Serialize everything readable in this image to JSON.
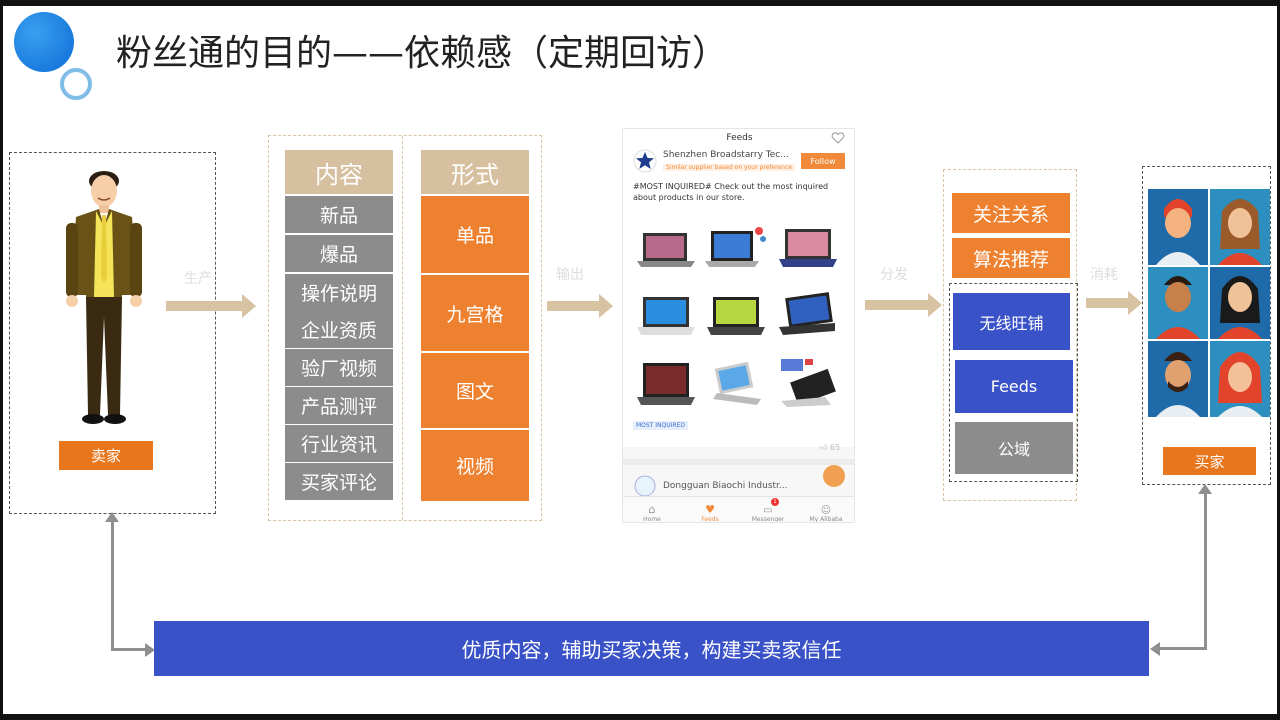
{
  "title": "粉丝通的目的——依赖感（定期回访）",
  "seller_label": "卖家",
  "buyer_label": "买家",
  "stages": {
    "produce": "生产",
    "output": "输出",
    "distribute": "分发",
    "consume": "消耗"
  },
  "content_column": {
    "header": "内容",
    "items": [
      "新品",
      "爆品",
      "操作说明",
      "企业资质",
      "验厂视频",
      "产品测评",
      "行业资讯",
      "买家评论"
    ]
  },
  "form_column": {
    "header": "形式",
    "items": [
      "单品",
      "九宫格",
      "图文",
      "视频"
    ]
  },
  "phone": {
    "header": "Feeds",
    "company": "Shenzhen Broadstarry Tec...",
    "subtitle": "Similar supplier based on your preference",
    "follow": "Follow",
    "post_text": "#MOST INQUIRED# Check out the most inquired about products in our store.",
    "badge": "MOST INQUIRED",
    "likes": "65",
    "company2": "Dongguan Biaochi Industr...",
    "nav": [
      "Home",
      "Feeds",
      "Messenger",
      "My Alibaba"
    ],
    "messenger_badge": "1"
  },
  "distribution": {
    "orange": [
      "关注关系",
      "算法推荐"
    ],
    "blue": [
      "无线旺铺",
      "Feeds"
    ],
    "grey": "公域"
  },
  "banner": "优质内容，辅助买家决策，构建买卖家信任",
  "colors": {
    "orange": "#ee8130",
    "blue": "#3a52c8",
    "tan": "#d6c0a0",
    "grey": "#8c8c8c"
  }
}
